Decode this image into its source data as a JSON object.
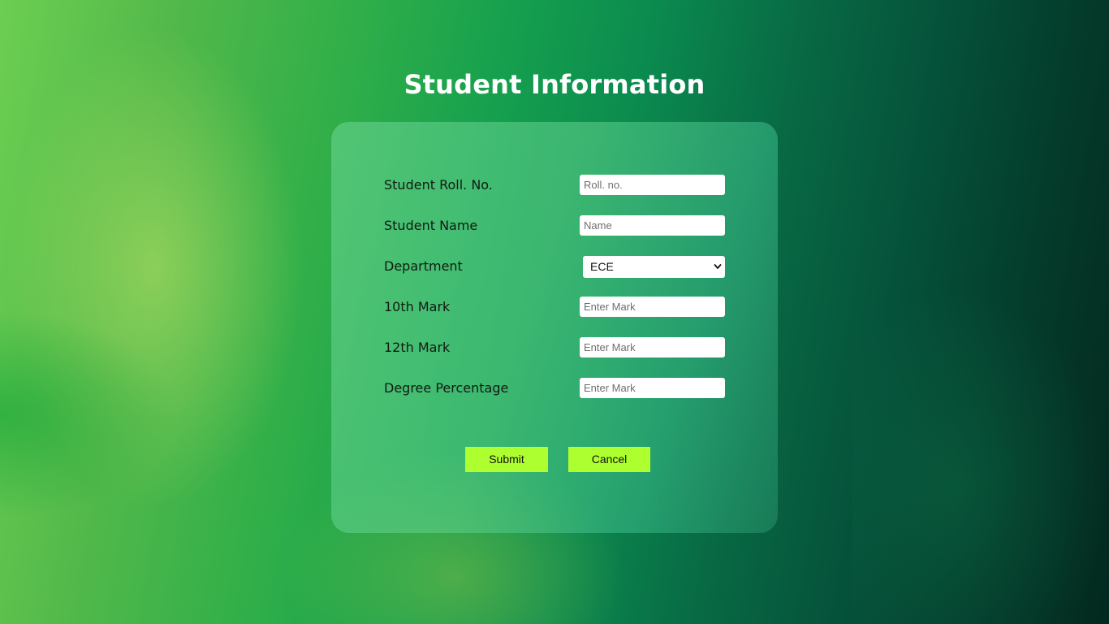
{
  "page": {
    "title": "Student Information"
  },
  "form": {
    "fields": [
      {
        "label": "Student Roll. No.",
        "placeholder": "Roll. no.",
        "type": "text"
      },
      {
        "label": "Student Name",
        "placeholder": "Name",
        "type": "text"
      },
      {
        "label": "Department",
        "value": "ECE",
        "type": "select"
      },
      {
        "label": "10th Mark",
        "placeholder": "Enter Mark",
        "type": "text"
      },
      {
        "label": "12th Mark",
        "placeholder": "Enter Mark",
        "type": "text"
      },
      {
        "label": "Degree Percentage",
        "placeholder": "Enter Mark",
        "type": "text"
      }
    ],
    "submit_label": "Submit",
    "cancel_label": "Cancel"
  },
  "colors": {
    "button_background": "#adff2f",
    "title_text": "#ffffff",
    "label_text": "#111a12"
  },
  "icons": {
    "select_arrow": "chevron-down-icon"
  }
}
